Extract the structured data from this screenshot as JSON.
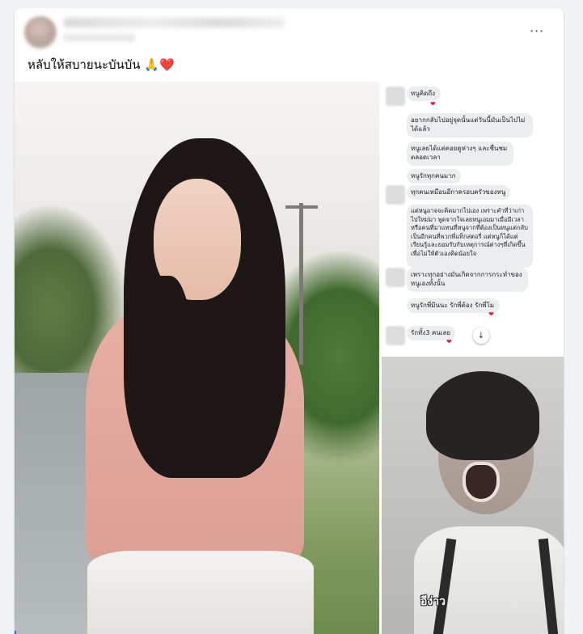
{
  "post": {
    "caption": "หลับให้สบายนะบันบัน",
    "caption_emoji_pray": "🙏",
    "caption_emoji_heart": "❤️",
    "more_icon": "⋯"
  },
  "chat": {
    "messages": [
      {
        "text": "หนูคิดถึง",
        "heart": "❤"
      },
      {
        "text": "อยากกลับไปอยู่จุดนั้นแต่วันนี้มันเป็นไปไม่ได้แล้ว"
      },
      {
        "text": "หนูเลยได้แต่คอยดูห่างๆ และชื่นชมตลอดเวลา"
      },
      {
        "text": "หนูรักทุกคนมาก"
      },
      {
        "text": "ทุกคนเหมือนอีกาครอบครัวของหนู"
      },
      {
        "text": "แต่หนูอาจจะคิดมากไปเอง เพราะคำที่ว่าเก่าไปใหม่มา พูดจากใจเลยหนูเอมมาเมื่อมีเวลาหรือคนที่มาแทนที่หนูจากที่ต้องเป็นหนูแต่กลับเป็นอีกคนที่พวกพี่แท็กสตอรี่ แต่หนูก็ได้แต่เรียนรู้และยอมรับกับเหตุการณ์ต่างๆที่เกิดขึ้น เพื่อไม่ให้ตัวเองคิดน้อยใจ"
      },
      {
        "text": "เพราะทุกอย่างมันเกิดจากการกระทำของหนูเองทั้งนั้น"
      },
      {
        "text": "หนูรักพี่มีนนะ รักพี่ต้อง รักพี่โม",
        "heart": "❤"
      },
      {
        "text": "รักทั้ง3 คนเลย",
        "heart": "❤"
      }
    ],
    "scroll_icon": "↓"
  },
  "meme": {
    "subtitle": "อีง่าว"
  }
}
